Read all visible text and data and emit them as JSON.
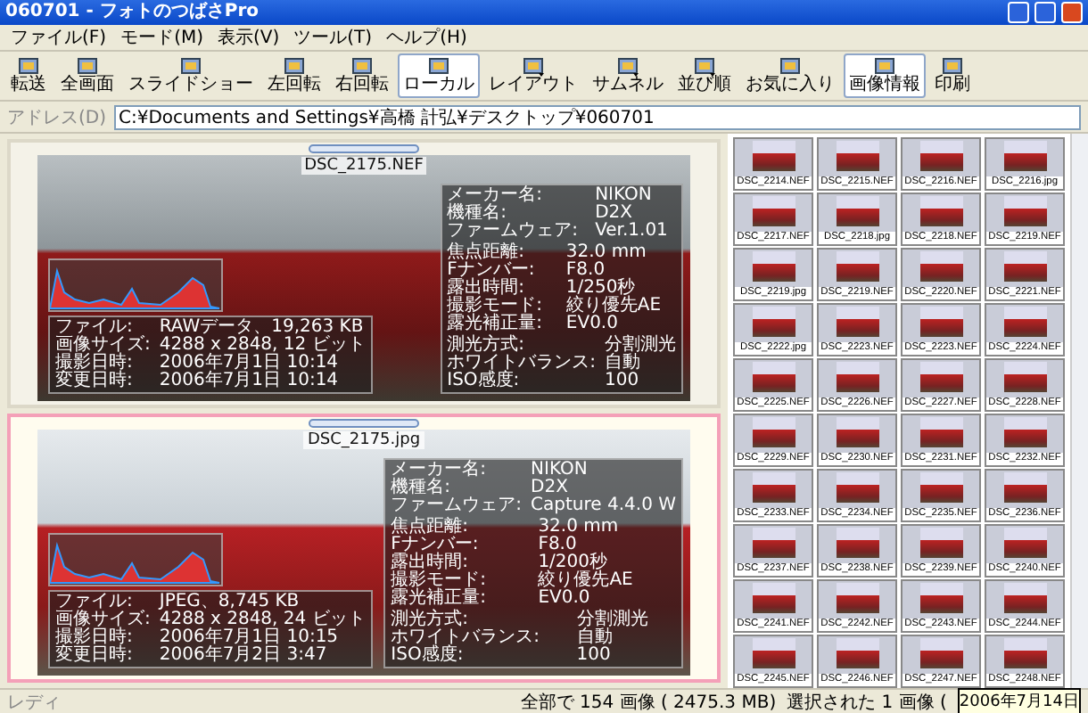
{
  "window": {
    "title": "060701 - フォトのつばさPro"
  },
  "menu": [
    "ファイル(F)",
    "モード(M)",
    "表示(V)",
    "ツール(T)",
    "ヘルプ(H)"
  ],
  "toolbar": [
    {
      "label": "転送",
      "selected": false,
      "dropdown": false
    },
    {
      "label": "全画面",
      "selected": false,
      "dropdown": false
    },
    {
      "label": "スライドショー",
      "selected": false,
      "dropdown": false
    },
    {
      "label": "左回転",
      "selected": false,
      "dropdown": false
    },
    {
      "label": "右回転",
      "selected": false,
      "dropdown": false
    },
    {
      "label": "ローカル",
      "selected": true,
      "dropdown": false
    },
    {
      "label": "レイアウト",
      "selected": false,
      "dropdown": true
    },
    {
      "label": "サムネル",
      "selected": false,
      "dropdown": true
    },
    {
      "label": "並び順",
      "selected": false,
      "dropdown": true
    },
    {
      "label": "お気に入り",
      "selected": false,
      "dropdown": false
    },
    {
      "label": "画像情報",
      "selected": true,
      "dropdown": false
    },
    {
      "label": "印刷",
      "selected": false,
      "dropdown": false
    }
  ],
  "address": {
    "label": "アドレス(D)",
    "value": "C:¥Documents and Settings¥高橋 計弘¥デスクトップ¥060701"
  },
  "photos": [
    {
      "filename": "DSC_2175.NEF",
      "selected": false,
      "file_info": [
        {
          "label": "ファイル:",
          "value": "RAWデータ、19,263 KB"
        },
        {
          "label": "画像サイズ:",
          "value": "4288 x 2848, 12 ビット"
        },
        {
          "label": "撮影日時:",
          "value": "2006年7月1日 10:14"
        },
        {
          "label": "変更日時:",
          "value": "2006年7月1日 10:14"
        }
      ],
      "exif": [
        [
          {
            "label": "メーカー名:",
            "value": "NIKON"
          },
          {
            "label": "機種名:",
            "value": "D2X"
          },
          {
            "label": "ファームウェア:",
            "value": "Ver.1.01"
          }
        ],
        [
          {
            "label": "焦点距離:",
            "value": "32.0 mm"
          },
          {
            "label": "Fナンバー:",
            "value": "F8.0"
          },
          {
            "label": "露出時間:",
            "value": "1/250秒"
          },
          {
            "label": "撮影モード:",
            "value": "絞り優先AE"
          },
          {
            "label": "露光補正量:",
            "value": "EV0.0"
          }
        ],
        [
          {
            "label": "測光方式:",
            "value": "分割測光"
          },
          {
            "label": "ホワイトバランス:",
            "value": "自動"
          },
          {
            "label": "ISO感度:",
            "value": "100"
          }
        ]
      ]
    },
    {
      "filename": "DSC_2175.jpg",
      "selected": true,
      "file_info": [
        {
          "label": "ファイル:",
          "value": "JPEG、8,745 KB"
        },
        {
          "label": "画像サイズ:",
          "value": "4288 x 2848, 24 ビット"
        },
        {
          "label": "撮影日時:",
          "value": "2006年7月1日 10:15"
        },
        {
          "label": "変更日時:",
          "value": "2006年7月2日 3:47"
        }
      ],
      "exif": [
        [
          {
            "label": "メーカー名:",
            "value": "NIKON"
          },
          {
            "label": "機種名:",
            "value": "D2X"
          },
          {
            "label": "ファームウェア:",
            "value": "Capture 4.4.0 W"
          }
        ],
        [
          {
            "label": "焦点距離:",
            "value": "32.0 mm"
          },
          {
            "label": "Fナンバー:",
            "value": "F8.0"
          },
          {
            "label": "露出時間:",
            "value": "1/200秒"
          },
          {
            "label": "撮影モード:",
            "value": "絞り優先AE"
          },
          {
            "label": "露光補正量:",
            "value": "EV0.0"
          }
        ],
        [
          {
            "label": "測光方式:",
            "value": "分割測光"
          },
          {
            "label": "ホワイトバランス:",
            "value": "自動"
          },
          {
            "label": "ISO感度:",
            "value": "100"
          }
        ]
      ]
    }
  ],
  "thumbnails": [
    "DSC_2214.NEF",
    "DSC_2215.NEF",
    "DSC_2216.NEF",
    "DSC_2216.jpg",
    "DSC_2217.NEF",
    "DSC_2218.jpg",
    "DSC_2218.NEF",
    "DSC_2219.NEF",
    "DSC_2219.jpg",
    "DSC_2219.NEF",
    "DSC_2220.NEF",
    "DSC_2221.NEF",
    "DSC_2222.jpg",
    "DSC_2223.NEF",
    "DSC_2223.NEF",
    "DSC_2224.NEF",
    "DSC_2225.NEF",
    "DSC_2226.NEF",
    "DSC_2227.NEF",
    "DSC_2228.NEF",
    "DSC_2229.NEF",
    "DSC_2230.NEF",
    "DSC_2231.NEF",
    "DSC_2232.NEF",
    "DSC_2233.NEF",
    "DSC_2234.NEF",
    "DSC_2235.NEF",
    "DSC_2236.NEF",
    "DSC_2237.NEF",
    "DSC_2238.NEF",
    "DSC_2239.NEF",
    "DSC_2240.NEF",
    "DSC_2241.NEF",
    "DSC_2242.NEF",
    "DSC_2243.NEF",
    "DSC_2244.NEF",
    "DSC_2245.NEF",
    "DSC_2246.NEF",
    "DSC_2247.NEF",
    "DSC_2248.NEF"
  ],
  "status_bar": {
    "ready": "レディ",
    "total": "全部で 154 画像 ( 2475.3 MB)",
    "selected": "選択された 1 画像 (",
    "tooltip": "2006年7月14日"
  }
}
